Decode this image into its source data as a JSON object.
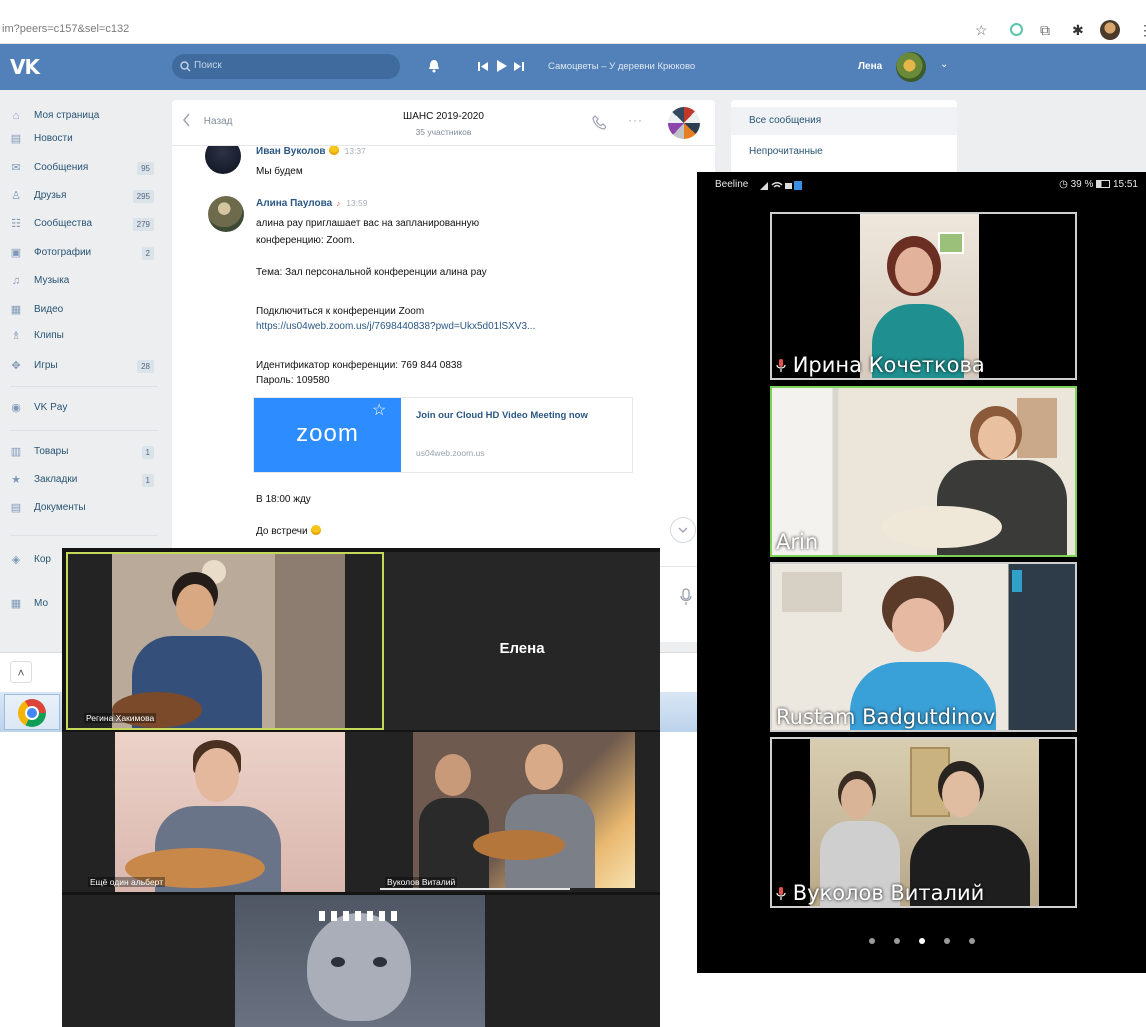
{
  "colors": {
    "vk_header": "#5181b8",
    "zoom_blue": "#2d8cff",
    "active_speaker": "#7dd35a",
    "link": "#2a5885"
  },
  "browser": {
    "url": "im?peers=c157&sel=c132",
    "toolbar_icons": [
      "star-icon",
      "extension-icon",
      "tab-icon",
      "puzzle-icon",
      "profile-avatar",
      "more-icon"
    ]
  },
  "vk": {
    "logo": "VK",
    "search_placeholder": "Поиск",
    "player": {
      "track": "Самоцветы – У деревни Крюково"
    },
    "user_name": "Лена",
    "sidebar": [
      {
        "label": "Моя страница",
        "icon": "home-icon"
      },
      {
        "label": "Новости",
        "icon": "news-icon"
      },
      {
        "label": "Сообщения",
        "count": "95",
        "icon": "messages-icon"
      },
      {
        "label": "Друзья",
        "count": "295",
        "icon": "friends-icon"
      },
      {
        "label": "Сообщества",
        "count": "279",
        "icon": "communities-icon"
      },
      {
        "label": "Фотографии",
        "count": "2",
        "icon": "photos-icon"
      },
      {
        "label": "Музыка",
        "icon": "music-icon"
      },
      {
        "label": "Видео",
        "icon": "video-icon"
      },
      {
        "label": "Клипы",
        "icon": "clips-icon"
      },
      {
        "label": "Игры",
        "count": "28",
        "icon": "games-icon"
      },
      {
        "label": "VK Pay",
        "icon": "vkpay-icon"
      },
      {
        "label": "Товары",
        "count": "1",
        "icon": "goods-icon"
      },
      {
        "label": "Закладки",
        "count": "1",
        "icon": "bookmarks-icon"
      },
      {
        "label": "Документы",
        "icon": "documents-icon"
      },
      {
        "label": "Кор",
        "icon": "app-icon"
      },
      {
        "label": "Мо",
        "icon": "apps-icon"
      }
    ],
    "chat": {
      "back_label": "Назад",
      "title": "ШАНС 2019-2020",
      "subtitle": "35 участников",
      "messages": [
        {
          "author": "Иван Вуколов",
          "time": "13:37",
          "lines": [
            "Мы будем"
          ]
        },
        {
          "author": "Алина Паулова",
          "time": "13:59",
          "lines": [
            "алина рау приглашает вас на запланированную",
            "конференцию: Zoom.",
            "Тема: Зал персональной конференции алина рау",
            "Подключиться к конференции Zoom",
            "https://us04web.zoom.us/j/7698440838?pwd=Ukx5d01lSXV3...",
            "Идентификатор конференции: 769 844 0838",
            "Пароль: 109580",
            "В 18:00 жду",
            "До встречи"
          ],
          "link_preview": {
            "logo": "zoom",
            "title": "Join our Cloud HD Video Meeting now",
            "domain": "us04web.zoom.us"
          }
        }
      ]
    },
    "right_panel": {
      "items": [
        "Все сообщения",
        "Непрочитанные"
      ]
    }
  },
  "zoom_desktop": {
    "tiles": [
      {
        "name": "Регина Хакимова",
        "active": true
      },
      {
        "name": "Елена",
        "video": false
      },
      {
        "name": "Ещё один альберт"
      },
      {
        "name": "Вуколов Виталий"
      },
      {
        "name": ""
      }
    ]
  },
  "zoom_mobile": {
    "status": {
      "carrier": "Beeline",
      "battery": "39 %",
      "time": "15:51"
    },
    "tiles": [
      {
        "name": "Ирина Кочеткова",
        "muted_icon": true
      },
      {
        "name": "Arin",
        "active": true
      },
      {
        "name": "Rustam Badgutdinov"
      },
      {
        "name": "Вуколов Виталий",
        "muted_icon": true
      }
    ],
    "pagination": {
      "count": 5,
      "current": 3
    }
  }
}
